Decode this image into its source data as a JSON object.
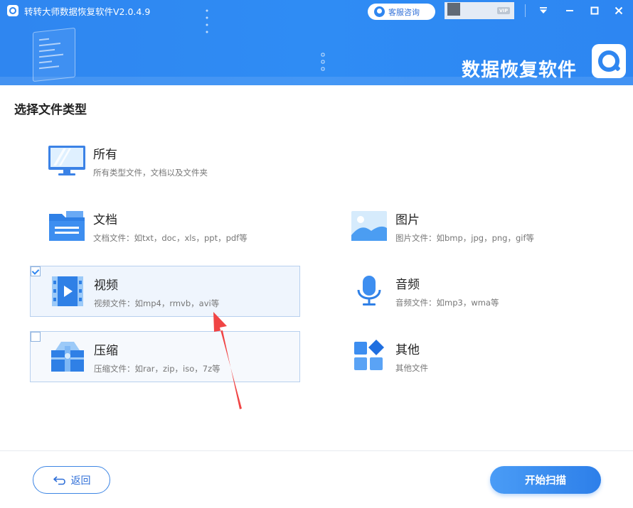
{
  "window": {
    "title": "转转大师数据恢复软件V2.0.4.9",
    "service_label": "客服咨询",
    "vip_label": "VIP",
    "brand_text": "数据恢复软件"
  },
  "page": {
    "section_title": "选择文件类型"
  },
  "file_types": [
    {
      "key": "all",
      "name": "所有",
      "desc": "所有类型文件，文档以及文件夹",
      "icon": "monitor-icon"
    },
    {
      "key": "document",
      "name": "文档",
      "desc": "文档文件：如txt，doc，xls，ppt，pdf等",
      "icon": "folder-icon"
    },
    {
      "key": "image",
      "name": "图片",
      "desc": "图片文件：如bmp，jpg，png，gif等",
      "icon": "image-icon"
    },
    {
      "key": "video",
      "name": "视频",
      "desc": "视频文件：如mp4，rmvb，avi等",
      "icon": "video-icon",
      "checked": true
    },
    {
      "key": "audio",
      "name": "音频",
      "desc": "音频文件：如mp3，wma等",
      "icon": "microphone-icon"
    },
    {
      "key": "archive",
      "name": "压缩",
      "desc": "压缩文件：如rar，zip，iso，7z等",
      "icon": "archive-icon",
      "checked": false
    },
    {
      "key": "other",
      "name": "其他",
      "desc": "其他文件",
      "icon": "apps-grid-icon"
    }
  ],
  "footer": {
    "back_label": "返回",
    "start_label": "开始扫描"
  },
  "colors": {
    "accent": "#2f86f0",
    "annotation_arrow": "#f04545"
  }
}
